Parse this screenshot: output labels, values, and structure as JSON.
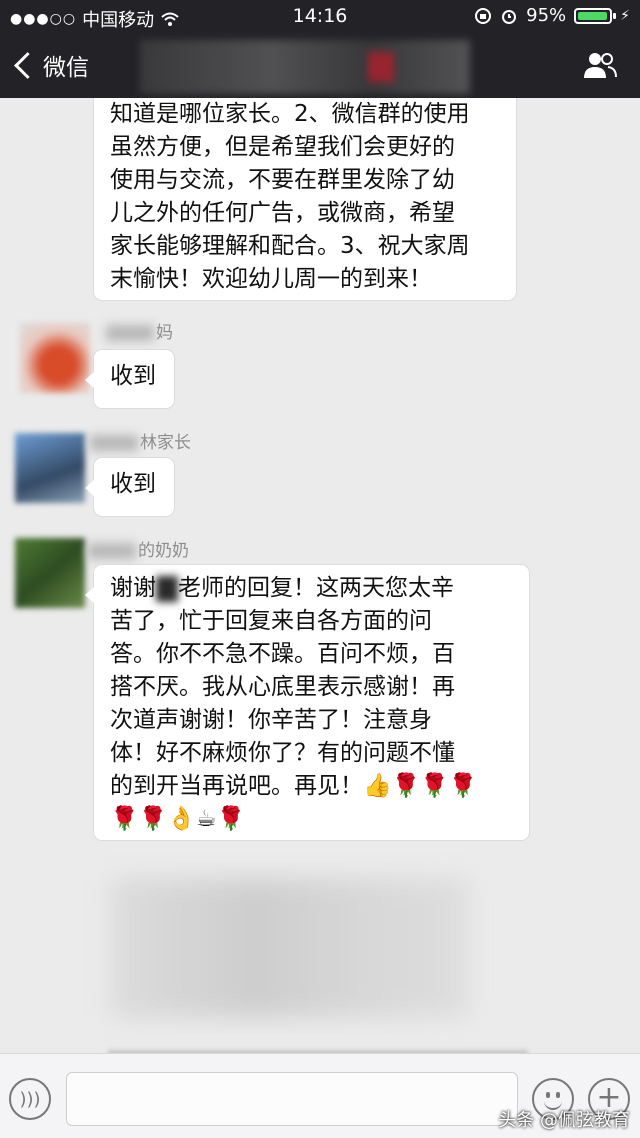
{
  "status": {
    "signal": "●●●○○",
    "carrier": "中国移动",
    "time": "14:16",
    "battery_text": "95%",
    "battery_level": 0.95
  },
  "nav": {
    "back_label": "微信"
  },
  "messages": [
    {
      "sender": "",
      "text_lines": [
        "知道是哪位家长。2、微信群的使用",
        "虽然方便，但是希望我们会更好的",
        "使用与交流，不要在群里发除了幼",
        "儿之外的任何广告，或微商，希望",
        "家长能够理解和配合。3、祝大家周",
        "末愉快！欢迎幼儿周一的到来！"
      ]
    },
    {
      "sender": "妈",
      "text": "收到"
    },
    {
      "sender": "林家长",
      "text": "收到"
    },
    {
      "sender": "的奶奶",
      "lines": [
        {
          "a": "谢谢",
          "b": "老师的回复！这两天您太辛"
        },
        {
          "a": "苦了，忙于回复来自各方面的问"
        },
        {
          "a": "答。你不不急不躁。百问不烦，百"
        },
        {
          "a": "搭不厌。我从心底里表示感谢！再"
        },
        {
          "a": "次道声谢谢！你辛苦了！注意身"
        },
        {
          "a": "体！好不麻烦你了？有的问题不懂"
        },
        {
          "a": "的到开当再说吧。再见！👍🌹🌹🌹"
        },
        {
          "a": "🌹🌹👌☕🌹"
        }
      ]
    }
  ],
  "watermark": "头条 @佩弦教育"
}
